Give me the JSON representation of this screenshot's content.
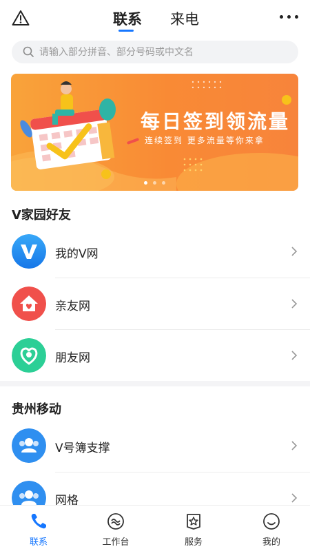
{
  "header": {
    "tabs": [
      {
        "label": "联系",
        "active": true
      },
      {
        "label": "来电",
        "active": false
      }
    ],
    "left_icon": "warning-triangle-icon",
    "right_icon": "more-dots-icon"
  },
  "search": {
    "placeholder": "请输入部分拼音、部分号码或中文名"
  },
  "banner": {
    "title": "每日签到领流量",
    "subtitle": "连续签到 更多流量等你来拿",
    "slide_count": 3,
    "active_slide": 1
  },
  "sections": [
    {
      "title": "V家园好友",
      "items": [
        {
          "label": "我的V网",
          "icon": "v-logo-icon",
          "color": "#1f8ef1"
        },
        {
          "label": "亲友网",
          "icon": "home-heart-icon",
          "color": "#f0504b"
        },
        {
          "label": "朋友网",
          "icon": "friends-heart-icon",
          "color": "#2ccf96"
        }
      ]
    },
    {
      "title": "贵州移动",
      "items": [
        {
          "label": "V号簿支撑",
          "icon": "group-users-icon",
          "color": "#2f8ff0"
        },
        {
          "label": "网格",
          "icon": "group-users-icon",
          "color": "#2f8ff0"
        }
      ]
    }
  ],
  "bottom_nav": [
    {
      "label": "联系",
      "icon": "phone-icon",
      "active": true
    },
    {
      "label": "工作台",
      "icon": "workbench-icon",
      "active": false
    },
    {
      "label": "服务",
      "icon": "service-star-icon",
      "active": false
    },
    {
      "label": "我的",
      "icon": "smiley-face-icon",
      "active": false
    }
  ],
  "colors": {
    "accent": "#1677ff",
    "banner_start": "#f9a33a",
    "banner_end": "#f7843b"
  }
}
